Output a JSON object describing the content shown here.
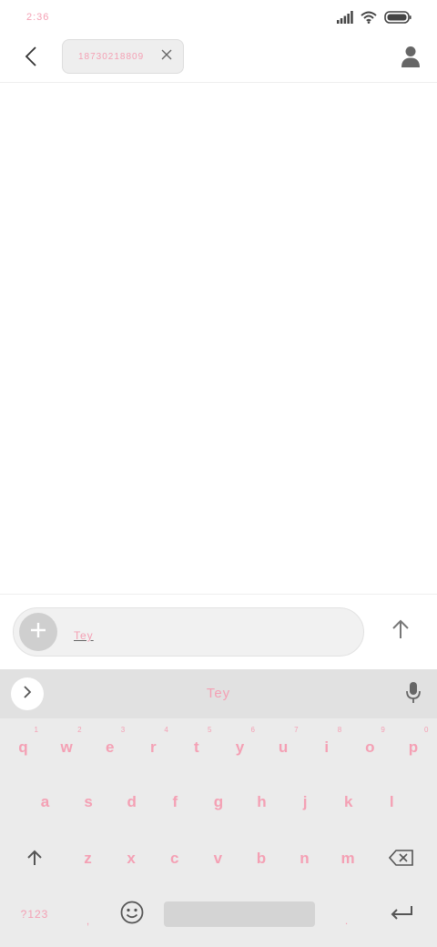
{
  "status_bar": {
    "time": "2:36"
  },
  "header": {
    "recipient_chip": {
      "number": "18730218809"
    },
    "icons": {
      "back": "chevron-left-icon",
      "remove": "close-icon",
      "contact": "person-icon"
    }
  },
  "compose": {
    "input_value": "Tey",
    "icons": {
      "add": "plus-icon",
      "send": "arrow-up-icon"
    }
  },
  "keyboard": {
    "suggestion": "Tey",
    "row1": [
      {
        "key": "q",
        "hint": "1"
      },
      {
        "key": "w",
        "hint": "2"
      },
      {
        "key": "e",
        "hint": "3"
      },
      {
        "key": "r",
        "hint": "4"
      },
      {
        "key": "t",
        "hint": "5"
      },
      {
        "key": "y",
        "hint": "6"
      },
      {
        "key": "u",
        "hint": "7"
      },
      {
        "key": "i",
        "hint": "8"
      },
      {
        "key": "o",
        "hint": "9"
      },
      {
        "key": "p",
        "hint": "0"
      }
    ],
    "row2": [
      "a",
      "s",
      "d",
      "f",
      "g",
      "h",
      "j",
      "k",
      "l"
    ],
    "row3": [
      "z",
      "x",
      "c",
      "v",
      "b",
      "n",
      "m"
    ],
    "bottom": {
      "symbols": "?123",
      "comma": ",",
      "period": "."
    }
  },
  "colors": {
    "accent": "#f4a0b4",
    "keyboard_bg": "#ebebeb",
    "suggestion_bg": "#e1e1e1"
  }
}
